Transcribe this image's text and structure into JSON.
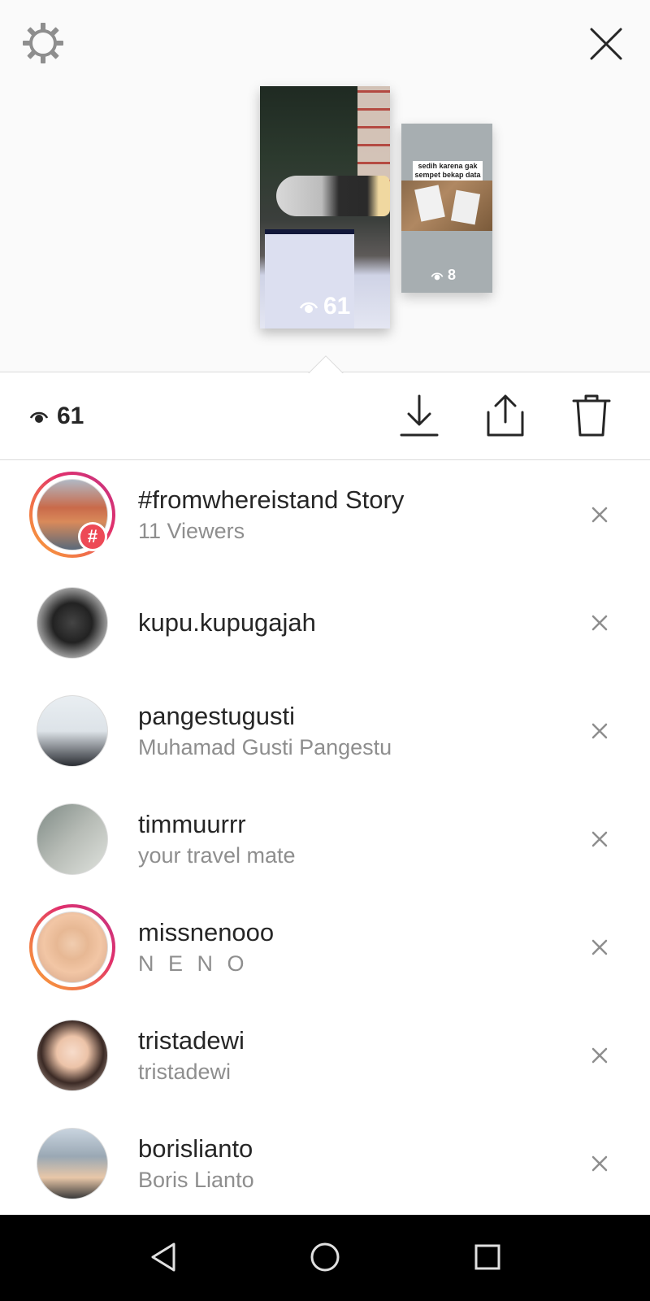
{
  "story_preview": {
    "main_views": "61",
    "second_views": "8",
    "second_caption": "sedih karena gak sempet bekap data"
  },
  "toolbar": {
    "view_count": "61"
  },
  "viewers": [
    {
      "username": "#fromwhereistand Story",
      "subtitle": "11 Viewers"
    },
    {
      "username": "kupu.kupugajah",
      "subtitle": ""
    },
    {
      "username": "pangestugusti",
      "subtitle": "Muhamad Gusti Pangestu"
    },
    {
      "username": "timmuurrr",
      "subtitle": "your travel mate"
    },
    {
      "username": "missnenooo",
      "subtitle": "N E N O"
    },
    {
      "username": "tristadewi",
      "subtitle": "tristadewi"
    },
    {
      "username": "borislianto",
      "subtitle": "Boris Lianto"
    }
  ],
  "hashtag_badge": "#",
  "colors": {
    "text_primary": "#262626",
    "text_secondary": "#8e8e8e",
    "divider": "#dbdbdb",
    "badge": "#ed4956"
  }
}
